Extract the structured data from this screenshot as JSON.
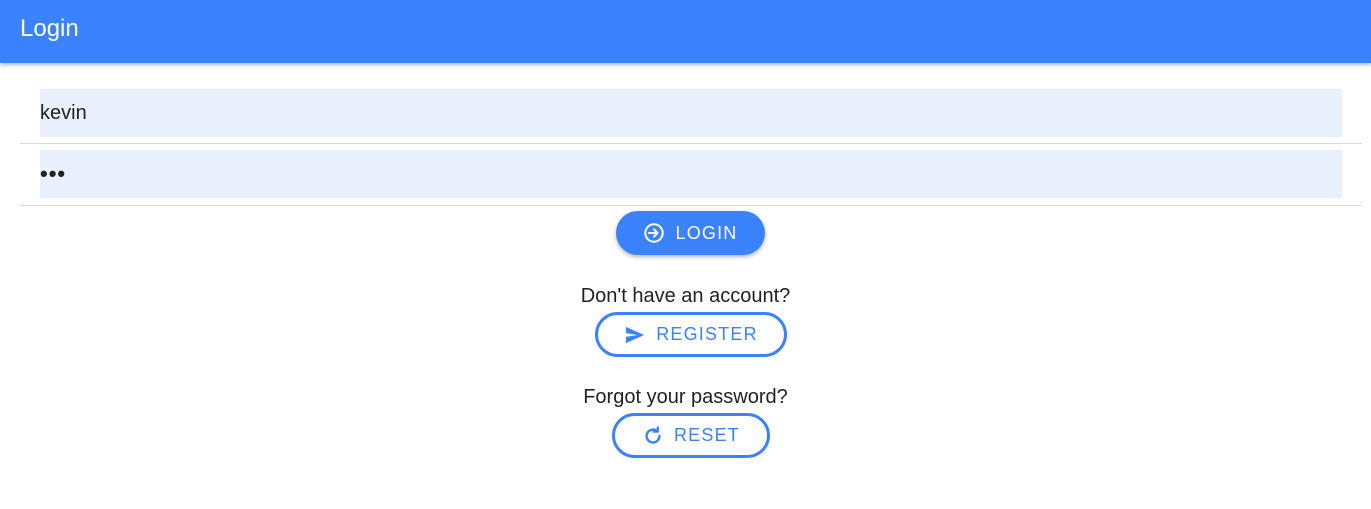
{
  "header": {
    "title": "Login",
    "color": "#3b82ff"
  },
  "form": {
    "username": {
      "value": "kevin",
      "placeholder": ""
    },
    "password": {
      "value": "•••",
      "placeholder": ""
    }
  },
  "actions": {
    "login": {
      "label": "LOGIN",
      "icon": "login-icon"
    },
    "register_prompt": "Don't have an account?",
    "register": {
      "label": "REGISTER",
      "icon": "send-icon"
    },
    "reset_prompt": "Forgot your password?",
    "reset": {
      "label": "RESET",
      "icon": "refresh-icon"
    }
  },
  "colors": {
    "primary": "#3b82ff",
    "input_bg": "#e8f0fe"
  }
}
